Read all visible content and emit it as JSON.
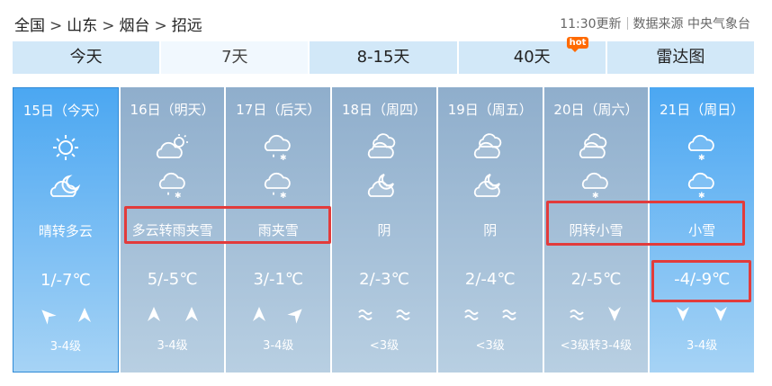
{
  "breadcrumb": [
    "全国",
    "山东",
    "烟台",
    "招远"
  ],
  "breadcrumb_sep": ">",
  "source": {
    "update": "11:30更新",
    "provider": "数据来源 中央气象台"
  },
  "tabs": [
    {
      "label": "今天",
      "active": false
    },
    {
      "label": "7天",
      "active": true
    },
    {
      "label": "8-15天",
      "active": false
    },
    {
      "label": "40天",
      "active": false,
      "badge": "hot"
    },
    {
      "label": "雷达图",
      "active": false
    }
  ],
  "days": [
    {
      "date": "15日（今天）",
      "icons": [
        "sun-icon",
        "partly-cloudy-night-icon"
      ],
      "desc": "晴转多云",
      "temp": "1/-7℃",
      "wind": [
        "wind-arrow-icon",
        "wind-arrow-icon"
      ],
      "level": "3-4级"
    },
    {
      "date": "16日（明天）",
      "icons": [
        "partly-cloudy-icon",
        "sleet-icon"
      ],
      "desc": "多云转雨夹雪",
      "temp": "5/-5℃",
      "wind": [
        "wind-arrow-icon",
        "wind-arrow-icon"
      ],
      "level": "3-4级"
    },
    {
      "date": "17日（后天）",
      "icons": [
        "sleet-icon",
        "sleet-icon"
      ],
      "desc": "雨夹雪",
      "temp": "3/-1℃",
      "wind": [
        "wind-arrow-icon",
        "wind-arrow-icon"
      ],
      "level": "3-4级"
    },
    {
      "date": "18日（周四）",
      "icons": [
        "overcast-icon",
        "cloudy-night-icon"
      ],
      "desc": "阴",
      "temp": "2/-3℃",
      "wind": [
        "wave-icon",
        "wave-icon"
      ],
      "level": "<3级"
    },
    {
      "date": "19日（周五）",
      "icons": [
        "overcast-icon",
        "cloudy-night-icon"
      ],
      "desc": "阴",
      "temp": "2/-4℃",
      "wind": [
        "wave-icon",
        "wave-icon"
      ],
      "level": "<3级"
    },
    {
      "date": "20日（周六）",
      "icons": [
        "overcast-icon",
        "light-snow-icon"
      ],
      "desc": "阴转小雪",
      "temp": "2/-5℃",
      "wind": [
        "wave-icon",
        "wind-arrow-icon"
      ],
      "level": "<3级转3-4级"
    },
    {
      "date": "21日（周日）",
      "icons": [
        "light-snow-icon",
        "light-snow-icon"
      ],
      "desc": "小雪",
      "temp": "-4/-9℃",
      "wind": [
        "wind-arrow-icon",
        "wind-arrow-icon"
      ],
      "level": "3-4级"
    }
  ],
  "colors": {
    "highlight": "#e23b3b",
    "today": "#4ba7f2",
    "tab": "#d2e8f8"
  }
}
